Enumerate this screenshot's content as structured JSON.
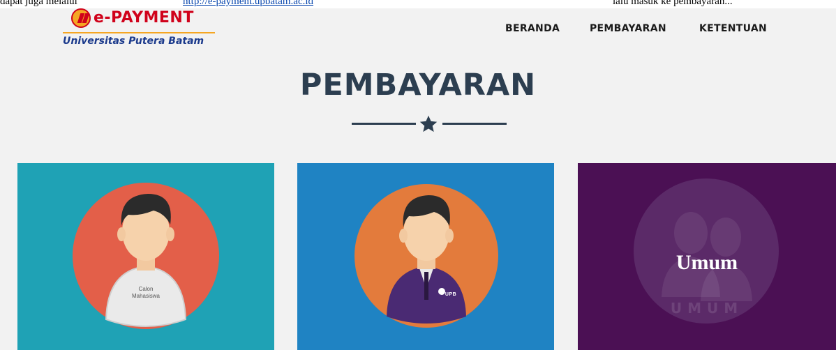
{
  "caption": {
    "pre": "dapat juga melalui ",
    "link": "http://e-payment.upbatam.ac.id",
    "post": " lalu masuk ke pembayaran..."
  },
  "brand": {
    "title": "e-PAYMENT",
    "subtitle": "Universitas Putera Batam"
  },
  "nav": {
    "items": [
      {
        "label": "BERANDA"
      },
      {
        "label": "PEMBAYARAN"
      },
      {
        "label": "KETENTUAN"
      }
    ]
  },
  "section": {
    "title": "PEMBAYARAN"
  },
  "cards": [
    {
      "tag_line1": "Calon",
      "tag_line2": "Mahasiswa"
    },
    {
      "badge": "UPB"
    },
    {
      "label": "Umum",
      "watermark": "UMUM"
    }
  ],
  "colors": {
    "card1": "#1fa2b5",
    "card2": "#1f83c3",
    "card3": "#4b1054",
    "heading": "#2c3e50",
    "brand": "#d0021b",
    "brand_sub": "#1b3a8c"
  }
}
